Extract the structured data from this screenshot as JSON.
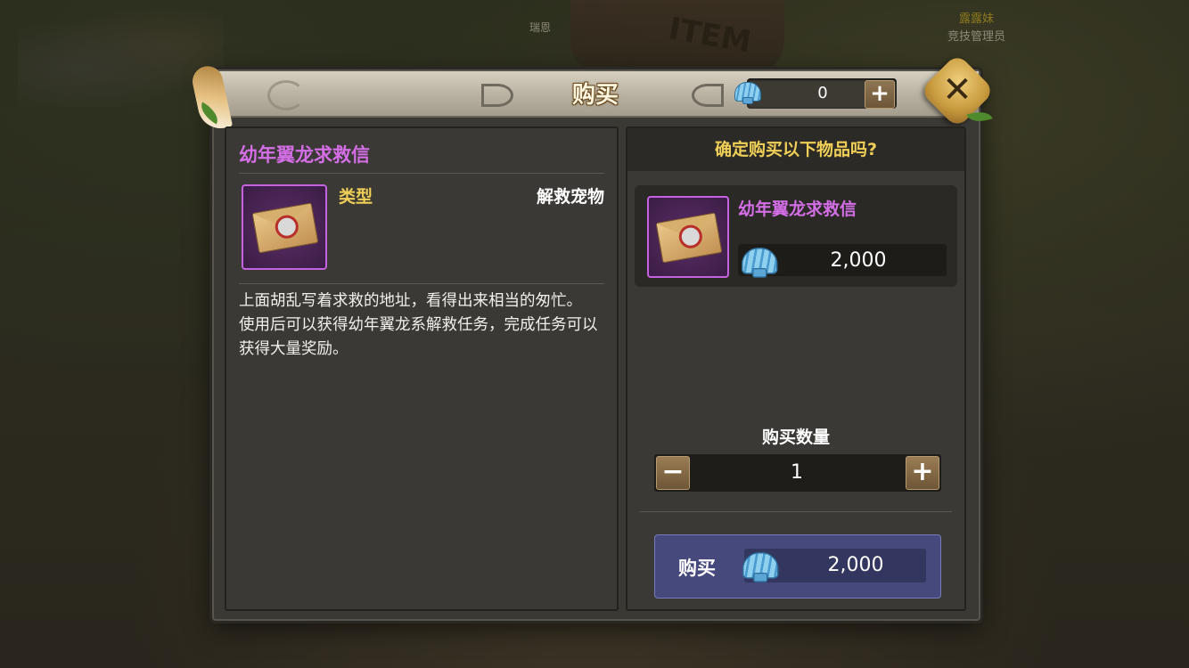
{
  "background": {
    "npc1_name": "瑞恩",
    "npc2_name": "露露妹",
    "npc2_title": "竞技管理员",
    "sign_text": "ITEM"
  },
  "dialog": {
    "title": "购买",
    "currency": {
      "icon": "shell-icon",
      "value": "0",
      "add_label": "+"
    },
    "close_label": "✕"
  },
  "item": {
    "name": "幼年翼龙求救信",
    "icon": "rescue-letter-icon",
    "type_label": "类型",
    "type_value": "解救宠物",
    "description": [
      "上面胡乱写着求救的地址，看得出来相当的匆忙。",
      "使用后可以获得幼年翼龙系解救任务，完成任务可以获得大量奖励。"
    ]
  },
  "purchase": {
    "confirm_text": "确定购买以下物品吗?",
    "item_name": "幼年翼龙求救信",
    "unit_price": "2,000",
    "quantity_label": "购买数量",
    "quantity": "1",
    "minus_label": "−",
    "plus_label": "+",
    "buy_label": "购买",
    "total_price": "2,000"
  },
  "colors": {
    "item_name": "#d46ee6",
    "label_gold": "#f0cf57",
    "buy_button": "#46497c"
  }
}
